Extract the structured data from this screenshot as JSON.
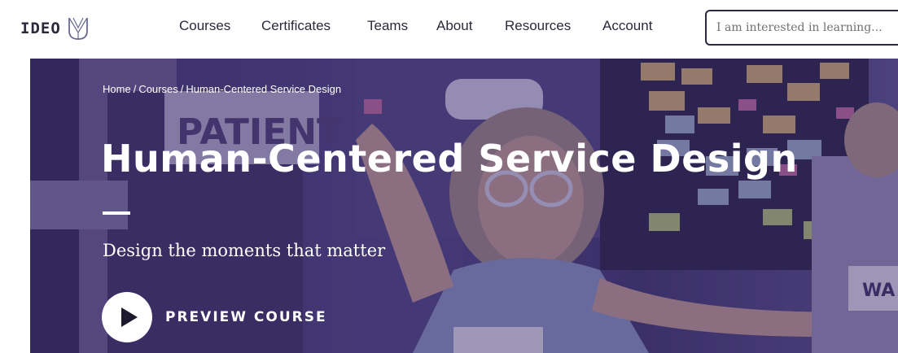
{
  "header": {
    "logo_text": "IDEO",
    "logo_mark_icon": "ideo-u-icon",
    "nav": [
      {
        "label": "Courses"
      },
      {
        "label": "Certificates"
      },
      {
        "label": "Teams"
      },
      {
        "label": "About"
      },
      {
        "label": "Resources"
      },
      {
        "label": "Account"
      }
    ],
    "search": {
      "value": "",
      "placeholder": "I am interested in learning..."
    }
  },
  "hero": {
    "breadcrumb": [
      {
        "label": "Home"
      },
      {
        "label": "Courses"
      },
      {
        "label": "Human-Centered Service Design"
      }
    ],
    "breadcrumb_separator": "/",
    "background_sign_text": "PATIENT",
    "background_tag_text": "WA",
    "title": "Human-Centered Service Design",
    "subtitle": "Design the moments that matter",
    "preview": {
      "icon": "play-icon",
      "label": "PREVIEW COURSE"
    }
  },
  "colors": {
    "text_dark": "#2a2a3c",
    "hero_overlay": "#3a2c6c",
    "white": "#ffffff"
  }
}
